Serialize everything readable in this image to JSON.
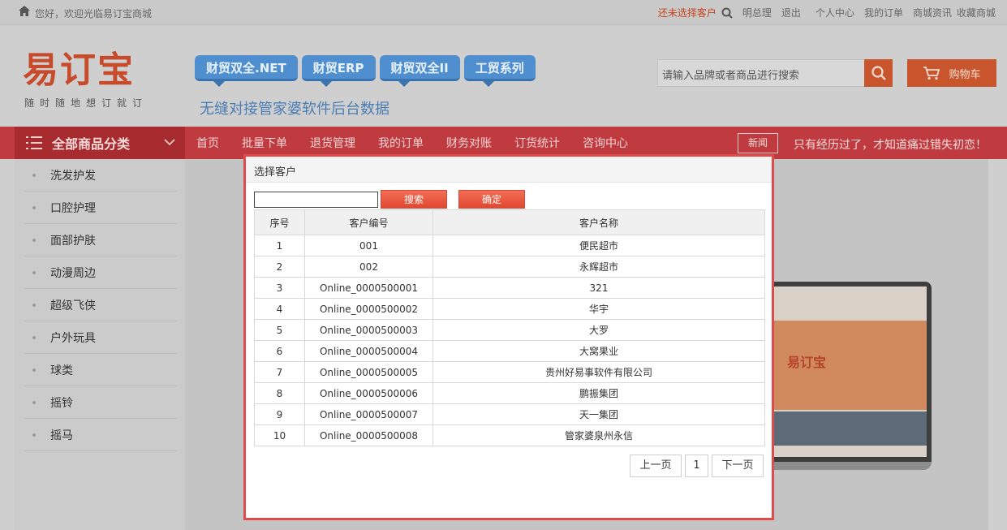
{
  "topbar": {
    "welcome": "您好，欢迎光临易订宝商城",
    "customer_status": "还未选择客户",
    "links": [
      "明总理",
      "退出",
      "个人中心",
      "我的订单",
      "商城资讯",
      "收藏商城"
    ]
  },
  "header": {
    "logo_text": "易订宝",
    "logo_slogan": "随时随地想订就订",
    "badges": [
      "财贸双全.NET",
      "财贸ERP",
      "财贸双全II",
      "工贸系列"
    ],
    "tagline": "无缝对接管家婆软件后台数据",
    "search_placeholder": "请输入品牌或者商品进行搜索",
    "cart_label": "购物车"
  },
  "nav": {
    "category_label": "全部商品分类",
    "items": [
      "首页",
      "批量下单",
      "退货管理",
      "我的订单",
      "财务对账",
      "订货统计",
      "咨询中心"
    ],
    "news_label": "新闻",
    "slogan": "只有经历过了，才知道痛过错失初恋！"
  },
  "sidebar": {
    "items": [
      "洗发护发",
      "口腔护理",
      "面部护肤",
      "动漫周边",
      "超级飞侠",
      "户外玩具",
      "球类",
      "摇铃",
      "摇马"
    ]
  },
  "banner": {
    "laptop_logo": "易订宝"
  },
  "modal": {
    "title": "选择客户",
    "search_value": "",
    "search_button": "搜索",
    "confirm_button": "确定",
    "columns": [
      "序号",
      "客户编号",
      "客户名称"
    ],
    "rows": [
      [
        "1",
        "001",
        "便民超市"
      ],
      [
        "2",
        "002",
        "永辉超市"
      ],
      [
        "3",
        "Online_0000500001",
        "321"
      ],
      [
        "4",
        "Online_0000500002",
        "华宇"
      ],
      [
        "5",
        "Online_0000500003",
        "大罗"
      ],
      [
        "6",
        "Online_0000500004",
        "大窝果业"
      ],
      [
        "7",
        "Online_0000500005",
        "贵州好易事软件有限公司"
      ],
      [
        "8",
        "Online_0000500006",
        "鹏振集团"
      ],
      [
        "9",
        "Online_0000500007",
        "天一集团"
      ],
      [
        "10",
        "Online_0000500008",
        "管家婆泉州永信"
      ]
    ],
    "pager": {
      "prev": "上一页",
      "page": "1",
      "next": "下一页"
    }
  },
  "colors": {
    "accent": "#c8552c",
    "nav": "#c03b3f",
    "modal_border": "#e04b4b"
  }
}
